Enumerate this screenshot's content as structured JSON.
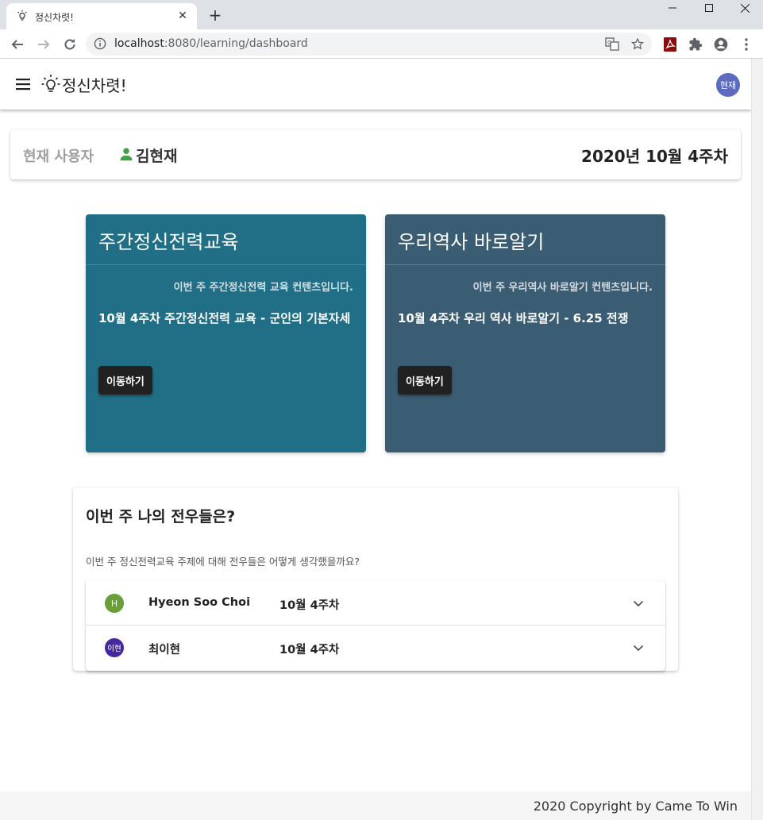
{
  "browser": {
    "tab_title": "정신차렷!",
    "url_host": "localhost",
    "url_rest": ":8080/learning/dashboard"
  },
  "app": {
    "brand": "정신차렷!",
    "avatar": "현재",
    "current_user_label": "현재 사용자",
    "current_user_name": "김현재",
    "week": "2020년 10월 4주차"
  },
  "cards": [
    {
      "title": "주간정신전력교육",
      "subtitle": "이번 주 주간정신전력 교육 컨텐츠입니다.",
      "content": "10월 4주차 주간정신전력 교육 - 군인의 기본자세",
      "button": "이동하기",
      "color": "#216f86"
    },
    {
      "title": "우리역사 바로알기",
      "subtitle": "이번 주 우리역사 바로알기 컨텐츠입니다.",
      "content": "10월 4주차 우리 역사 바로알기 - 6.25 전쟁",
      "button": "이동하기",
      "color": "#3a5d73"
    }
  ],
  "comrades": {
    "title": "이번 주 나의 전우들은?",
    "subtitle": "이번 주 정신전력교육 주제에 대해 전우들은 어떻게 생각했을까요?",
    "people": [
      {
        "avatar": "H",
        "avatar_color": "#689f38",
        "name": "Hyeon Soo Choi",
        "week": "10월 4주차"
      },
      {
        "avatar": "이현",
        "avatar_color": "#4527a0",
        "name": "최이현",
        "week": "10월 4주차"
      }
    ]
  },
  "footer": {
    "copyright": "2020 Copyright by Came To Win"
  },
  "icons": {
    "tab_favicon": "lightbulb-icon",
    "tab_close": "close-icon",
    "new_tab": "plus-icon",
    "back": "arrow-left-icon",
    "forward": "arrow-right-icon",
    "reload": "reload-icon",
    "site_info": "info-icon",
    "translate": "translate-icon",
    "bookmark": "star-icon",
    "pdf_ext": "pdf-icon",
    "extensions": "puzzle-icon",
    "profile": "account-circle-icon",
    "menu": "more-vert-icon",
    "hamburger": "menu-icon",
    "brand": "lightbulb-icon",
    "user": "person-icon",
    "expand": "chevron-down-icon"
  }
}
